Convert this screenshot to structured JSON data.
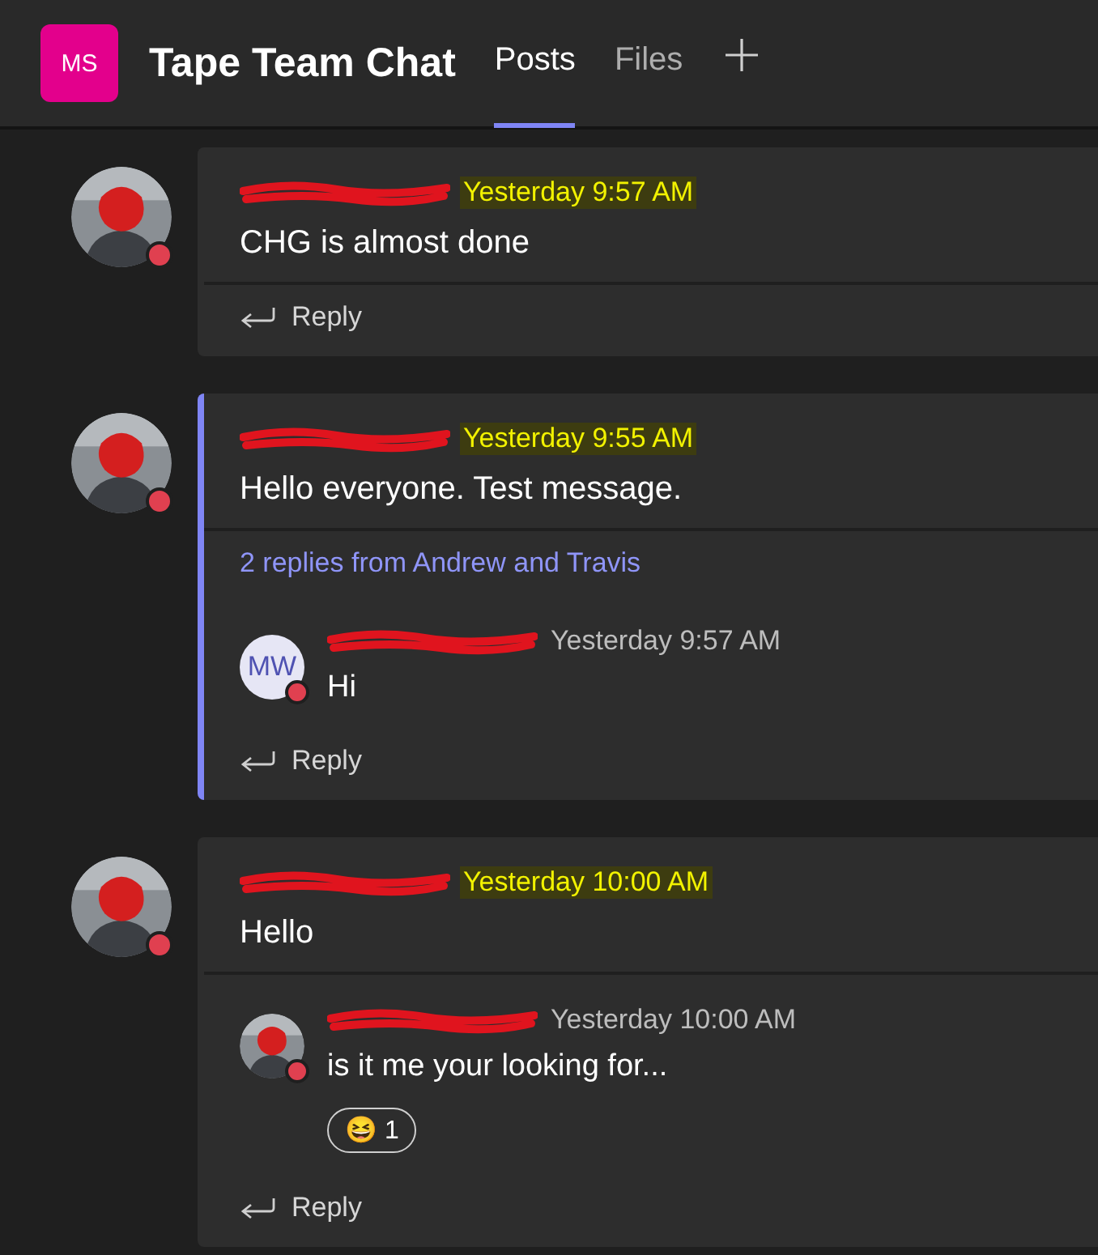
{
  "header": {
    "team_initials": "MS",
    "title": "Tape Team Chat",
    "tabs": [
      {
        "label": "Posts",
        "selected": true
      },
      {
        "label": "Files",
        "selected": false
      }
    ]
  },
  "posts": [
    {
      "accent": false,
      "avatar": {
        "kind": "picture"
      },
      "time": "Yesterday 9:57 AM",
      "time_highlighted": true,
      "text": "CHG is almost done",
      "reply_label": "Reply"
    },
    {
      "accent": true,
      "avatar": {
        "kind": "picture"
      },
      "time": "Yesterday 9:55 AM",
      "time_highlighted": true,
      "text": "Hello everyone. Test message.",
      "replies_summary": "2 replies from Andrew and Travis",
      "replies": [
        {
          "avatar": {
            "kind": "initials",
            "initials": "MW"
          },
          "time": "Yesterday 9:57 AM",
          "text": "Hi"
        }
      ],
      "reply_label": "Reply"
    },
    {
      "accent": false,
      "avatar": {
        "kind": "picture"
      },
      "time": "Yesterday 10:00 AM",
      "time_highlighted": true,
      "text": "Hello",
      "replies": [
        {
          "avatar": {
            "kind": "picture"
          },
          "time": "Yesterday 10:00 AM",
          "text": "is it me your looking for...",
          "reactions": [
            {
              "emoji": "😆",
              "count": "1"
            }
          ]
        }
      ],
      "reply_label": "Reply"
    }
  ]
}
